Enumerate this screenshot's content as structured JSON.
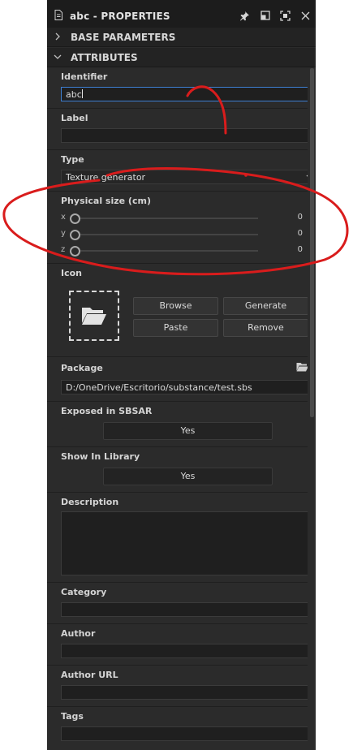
{
  "window": {
    "title": "abc - PROPERTIES",
    "doc_icon": "document-icon",
    "buttons": [
      "pin-icon",
      "float-window-icon",
      "maximize-icon",
      "close-icon"
    ]
  },
  "sections": {
    "base_parameters": {
      "label": "BASE PARAMETERS",
      "expanded": false
    },
    "attributes": {
      "label": "ATTRIBUTES",
      "expanded": true
    }
  },
  "fields": {
    "identifier": {
      "label": "Identifier",
      "value": "abc"
    },
    "label": {
      "label": "Label",
      "value": ""
    },
    "type": {
      "label": "Type",
      "value": "Texture generator"
    },
    "physical_size": {
      "label": "Physical size (cm)",
      "axes": [
        {
          "axis": "x",
          "value": "0"
        },
        {
          "axis": "y",
          "value": "0"
        },
        {
          "axis": "z",
          "value": "0"
        }
      ]
    },
    "icon": {
      "label": "Icon",
      "placeholder_icon": "folder-open-icon",
      "buttons": {
        "browse": "Browse",
        "generate": "Generate",
        "paste": "Paste",
        "remove": "Remove"
      }
    },
    "package": {
      "label": "Package",
      "value": "D:/OneDrive/Escritorio/substance/test.sbs",
      "browse_icon": "folder-icon"
    },
    "exposed_in_sbsar": {
      "label": "Exposed in SBSAR",
      "value": "Yes"
    },
    "show_in_library": {
      "label": "Show In Library",
      "value": "Yes"
    },
    "description": {
      "label": "Description",
      "value": ""
    },
    "category": {
      "label": "Category",
      "value": ""
    },
    "author": {
      "label": "Author",
      "value": ""
    },
    "author_url": {
      "label": "Author URL",
      "value": ""
    },
    "tags": {
      "label": "Tags",
      "value": ""
    }
  },
  "colors": {
    "panel_bg": "#2b2b2b",
    "focus_border": "#3d7fd1",
    "annotation_red": "#d91c1c"
  }
}
